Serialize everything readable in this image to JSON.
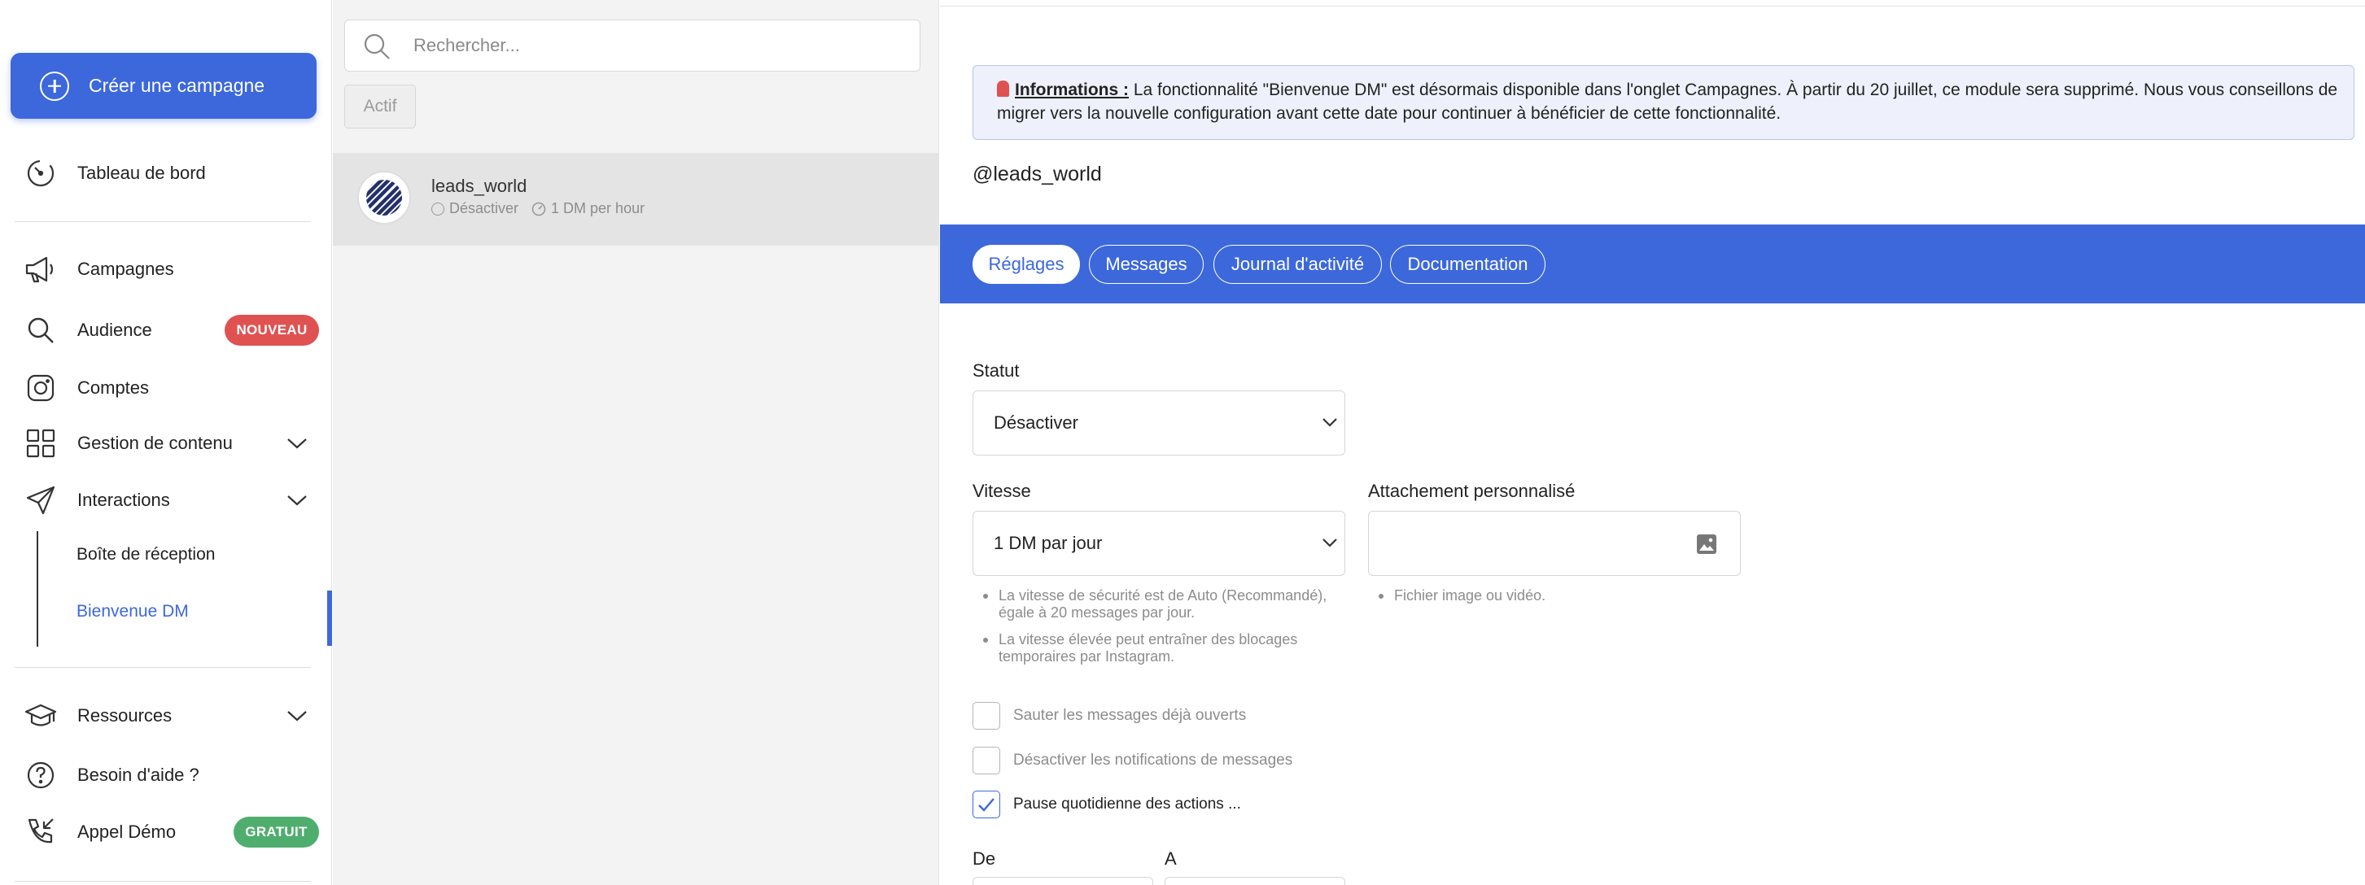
{
  "sidebar": {
    "create_label": "Créer une campagne",
    "items": {
      "dashboard": "Tableau de bord",
      "campaigns": "Campagnes",
      "audience": "Audience",
      "audience_badge": "NOUVEAU",
      "accounts": "Comptes",
      "content": "Gestion de contenu",
      "interactions": "Interactions",
      "inbox": "Boîte de réception",
      "welcome_dm": "Bienvenue DM",
      "resources": "Ressources",
      "help": "Besoin d'aide ?",
      "demo": "Appel Démo",
      "demo_badge": "GRATUIT"
    }
  },
  "list": {
    "search_placeholder": "Rechercher...",
    "filter_label": "Actif",
    "account": {
      "name": "leads_world",
      "status": "Désactiver",
      "rate": "1 DM per hour"
    }
  },
  "main": {
    "info_title": "Informations :",
    "info_text": "La fonctionnalité \"Bienvenue DM\" est désormais disponible dans l'onglet Campagnes. À partir du 20 juillet, ce module sera supprimé. Nous vous conseillons de migrer vers la nouvelle configuration avant cette date pour continuer à bénéficier de cette fonctionnalité.",
    "handle": "@leads_world",
    "tabs": [
      "Réglages",
      "Messages",
      "Journal d'activité",
      "Documentation"
    ],
    "active_tab": 0,
    "status_label": "Statut",
    "status_value": "Désactiver",
    "speed_label": "Vitesse",
    "speed_value": "1 DM par jour",
    "attach_label": "Attachement personnalisé",
    "speed_hints": [
      "La vitesse de sécurité est de Auto (Recommandé), égale à 20 messages par jour.",
      "La vitesse élevée peut entraîner des blocages temporaires par Instagram."
    ],
    "attach_hint": "Fichier image ou vidéo.",
    "checkboxes": [
      {
        "label": "Sauter les messages déjà ouverts",
        "checked": false
      },
      {
        "label": "Désactiver les notifications de messages",
        "checked": false
      },
      {
        "label": "Pause quotidienne des actions ...",
        "checked": true
      }
    ],
    "from_label": "De",
    "to_label": "A"
  },
  "colors": {
    "accent": "#3c68dc",
    "badge_new": "#e05252",
    "badge_free": "#4fae6e"
  }
}
